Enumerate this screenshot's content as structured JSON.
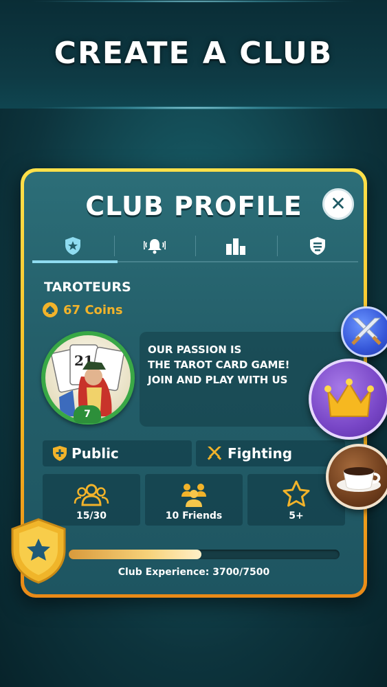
{
  "header": {
    "title": "CREATE A CLUB"
  },
  "panel": {
    "title": "CLUB PROFILE",
    "close_icon": "close-icon",
    "tabs": [
      {
        "icon": "shield-star-icon",
        "active": true
      },
      {
        "icon": "bell-icon",
        "active": false
      },
      {
        "icon": "bar-chart-icon",
        "active": false
      },
      {
        "icon": "rules-shield-icon",
        "active": false
      }
    ],
    "club": {
      "name": "TAROTEURS",
      "coins": "67 Coins",
      "level": "7",
      "description": "OUR PASSION IS\nTHE TAROT CARD GAME!\nJOIN AND PLAY WITH US",
      "visibility": "Public",
      "style": "Fighting",
      "members": "15/30",
      "friends": "10 Friends",
      "min_level": "5+",
      "experience_label": "Club Experience:  3700/7500",
      "experience_fraction": 0.49
    }
  },
  "side_buttons": [
    {
      "icon": "swords-icon"
    },
    {
      "icon": "crown-icon"
    },
    {
      "icon": "coffee-cup-icon"
    }
  ],
  "colors": {
    "accent_gold": "#f6b820",
    "panel_teal": "#245f6a",
    "coin_gold": "#f2b32a",
    "level_green": "#39a846"
  }
}
